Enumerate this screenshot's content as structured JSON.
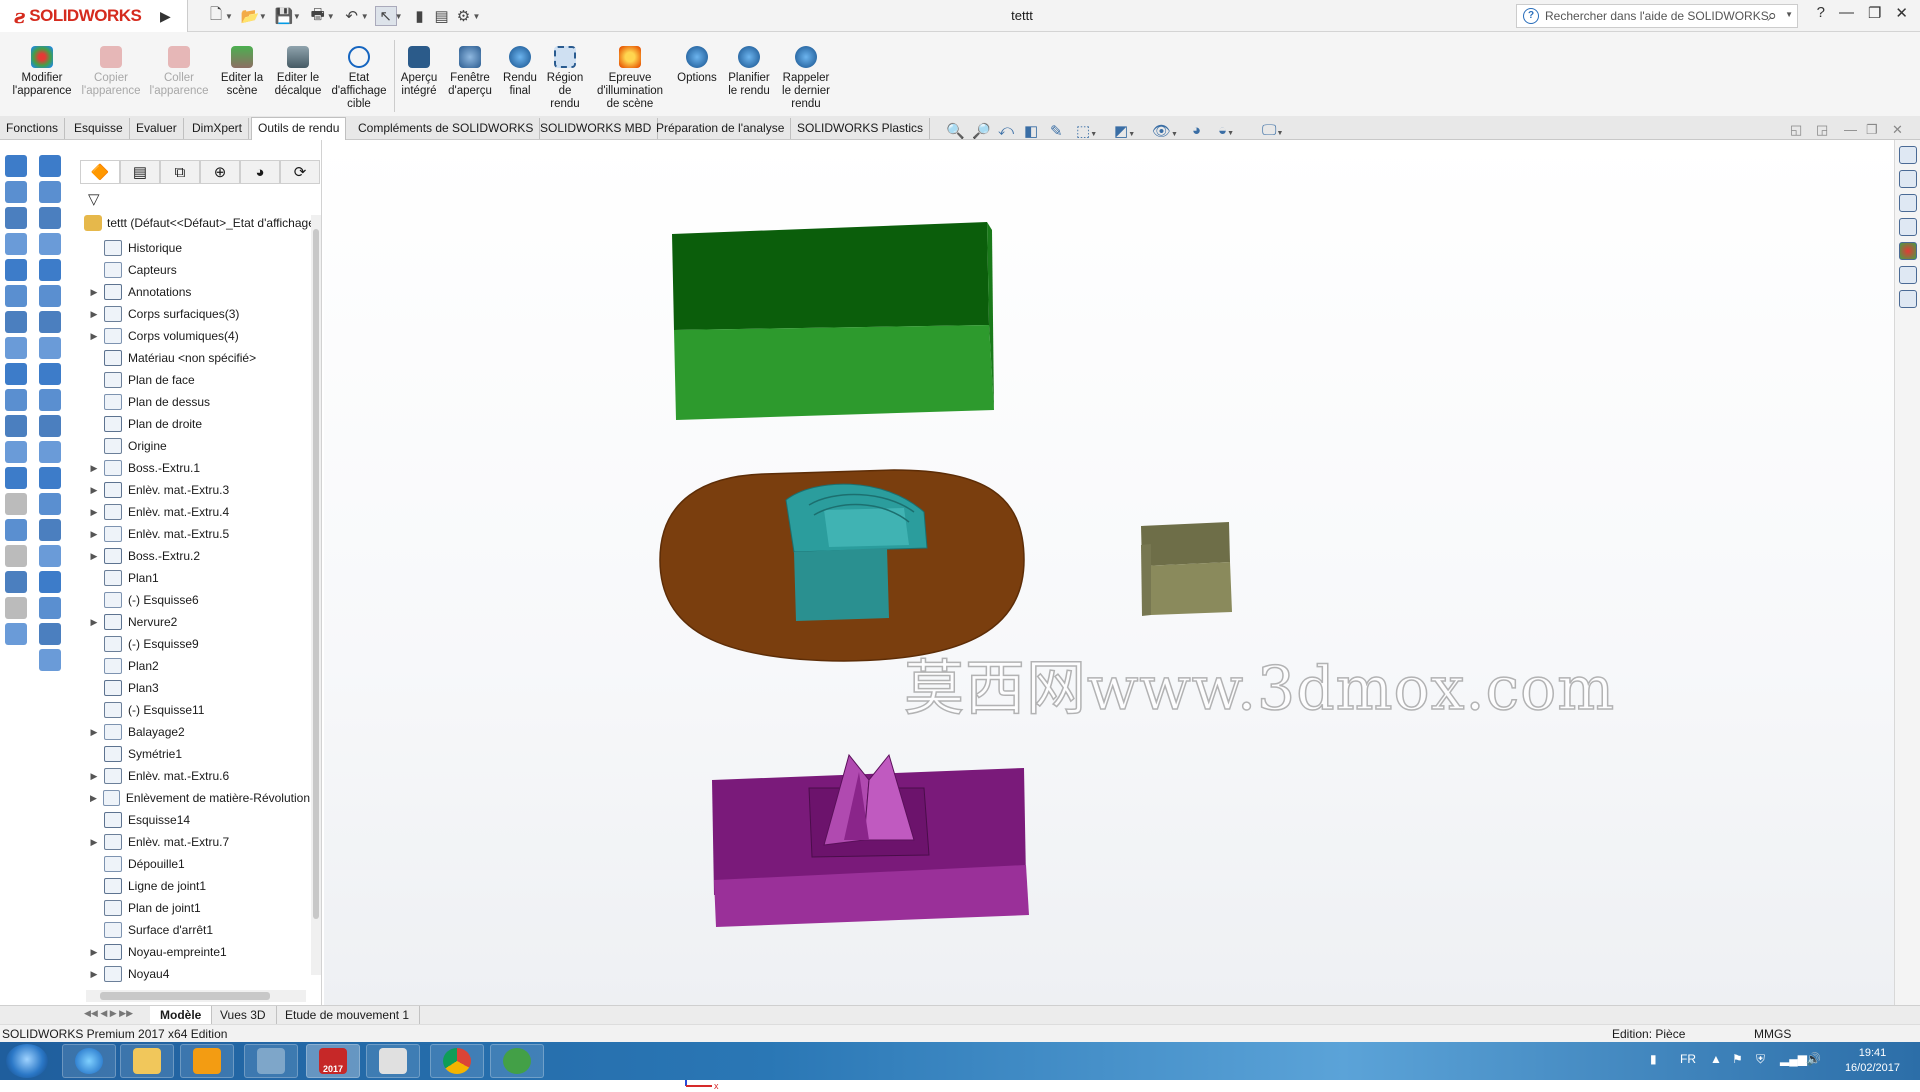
{
  "app": {
    "brand": "SOLIDWORKS",
    "document_title": "tettt"
  },
  "help_search": {
    "placeholder": "Rechercher dans l'aide de SOLIDWORKS"
  },
  "window_controls": [
    "?",
    "—",
    "❐",
    "✕"
  ],
  "command_manager": [
    {
      "label_line1": "Modifier",
      "label_line2": "l'apparence",
      "label_line3": "",
      "enabled": true
    },
    {
      "label_line1": "Copier",
      "label_line2": "l'apparence",
      "label_line3": "",
      "enabled": false
    },
    {
      "label_line1": "Coller",
      "label_line2": "l'apparence",
      "label_line3": "",
      "enabled": false
    },
    {
      "label_line1": "Editer la",
      "label_line2": "scène",
      "label_line3": "",
      "enabled": true
    },
    {
      "label_line1": "Editer le",
      "label_line2": "décalque",
      "label_line3": "",
      "enabled": true
    },
    {
      "label_line1": "Etat",
      "label_line2": "d'affichage",
      "label_line3": "cible",
      "enabled": true
    },
    {
      "label_line1": "Aperçu",
      "label_line2": "intégré",
      "label_line3": "",
      "enabled": true
    },
    {
      "label_line1": "Fenêtre",
      "label_line2": "d'aperçu",
      "label_line3": "",
      "enabled": true
    },
    {
      "label_line1": "Rendu",
      "label_line2": "final",
      "label_line3": "",
      "enabled": true
    },
    {
      "label_line1": "Région",
      "label_line2": "de",
      "label_line3": "rendu",
      "enabled": true
    },
    {
      "label_line1": "Epreuve",
      "label_line2": "d'illumination",
      "label_line3": "de scène",
      "enabled": true
    },
    {
      "label_line1": "Options",
      "label_line2": "",
      "label_line3": "",
      "enabled": true
    },
    {
      "label_line1": "Planifier",
      "label_line2": "le rendu",
      "label_line3": "",
      "enabled": true
    },
    {
      "label_line1": "Rappeler",
      "label_line2": "le dernier",
      "label_line3": "rendu",
      "enabled": true
    }
  ],
  "tabs": [
    "Fonctions",
    "Esquisse",
    "Evaluer",
    "DimXpert",
    "Outils de rendu",
    "Compléments de SOLIDWORKS",
    "SOLIDWORKS MBD",
    "Préparation de l'analyse",
    "SOLIDWORKS Plastics"
  ],
  "active_tab": "Outils de rendu",
  "feature_tree": {
    "root": "tettt  (Défaut<<Défaut>_Etat d'affichage",
    "items": [
      {
        "label": "Historique",
        "expandable": false
      },
      {
        "label": "Capteurs",
        "expandable": false
      },
      {
        "label": "Annotations",
        "expandable": true
      },
      {
        "label": "Corps surfaciques(3)",
        "expandable": true
      },
      {
        "label": "Corps volumiques(4)",
        "expandable": true
      },
      {
        "label": "Matériau <non spécifié>",
        "expandable": false
      },
      {
        "label": "Plan de face",
        "expandable": false
      },
      {
        "label": "Plan de dessus",
        "expandable": false
      },
      {
        "label": "Plan de droite",
        "expandable": false
      },
      {
        "label": "Origine",
        "expandable": false
      },
      {
        "label": "Boss.-Extru.1",
        "expandable": true
      },
      {
        "label": "Enlèv. mat.-Extru.3",
        "expandable": true
      },
      {
        "label": "Enlèv. mat.-Extru.4",
        "expandable": true
      },
      {
        "label": "Enlèv. mat.-Extru.5",
        "expandable": true
      },
      {
        "label": "Boss.-Extru.2",
        "expandable": true
      },
      {
        "label": "Plan1",
        "expandable": false
      },
      {
        "label": "(-) Esquisse6",
        "expandable": false
      },
      {
        "label": "Nervure2",
        "expandable": true
      },
      {
        "label": "(-) Esquisse9",
        "expandable": false
      },
      {
        "label": "Plan2",
        "expandable": false
      },
      {
        "label": "Plan3",
        "expandable": false
      },
      {
        "label": "(-) Esquisse11",
        "expandable": false
      },
      {
        "label": "Balayage2",
        "expandable": true
      },
      {
        "label": "Symétrie1",
        "expandable": false
      },
      {
        "label": "Enlèv. mat.-Extru.6",
        "expandable": true
      },
      {
        "label": "Enlèvement de matière-Révolution",
        "expandable": true
      },
      {
        "label": "Esquisse14",
        "expandable": false
      },
      {
        "label": "Enlèv. mat.-Extru.7",
        "expandable": true
      },
      {
        "label": "Dépouille1",
        "expandable": false
      },
      {
        "label": "Ligne de joint1",
        "expandable": false
      },
      {
        "label": "Plan de joint1",
        "expandable": false
      },
      {
        "label": "Surface d'arrêt1",
        "expandable": false
      },
      {
        "label": "Noyau-empreinte1",
        "expandable": true
      },
      {
        "label": "Noyau4",
        "expandable": true
      }
    ]
  },
  "watermark": "莫西网www.3dmox.com",
  "bottom_tabs": [
    "Modèle",
    "Vues 3D",
    "Etude de mouvement 1"
  ],
  "status": {
    "product": "SOLIDWORKS Premium 2017 x64 Edition",
    "edition": "Edition: Pièce",
    "units": "MMGS"
  },
  "taskbar": {
    "lang": "FR",
    "time": "19:41",
    "date": "16/02/2017",
    "sw_badge": "2017"
  },
  "colors": {
    "green_body": "#1f8c1f",
    "brown_body": "#7a3e0e",
    "teal_core": "#2b9d9d",
    "olive_block": "#8a8a5c",
    "purple_body": "#8d1a8d"
  }
}
